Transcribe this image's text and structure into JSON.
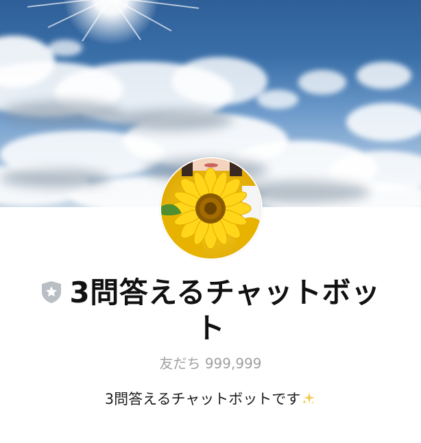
{
  "profile": {
    "name": "3問答えるチャットボット",
    "friends_label": "友だち",
    "friends_count": "999,999",
    "status_message": "3問答えるチャットボットです",
    "status_emoji": "sparkles-icon",
    "badge_icon": "shield-star-icon"
  },
  "colors": {
    "badge": "#b9bec4",
    "friends_text": "#a0a0a0",
    "name_text": "#111111",
    "status_text": "#1a1a1a",
    "sparkle": "#f2c94c"
  }
}
